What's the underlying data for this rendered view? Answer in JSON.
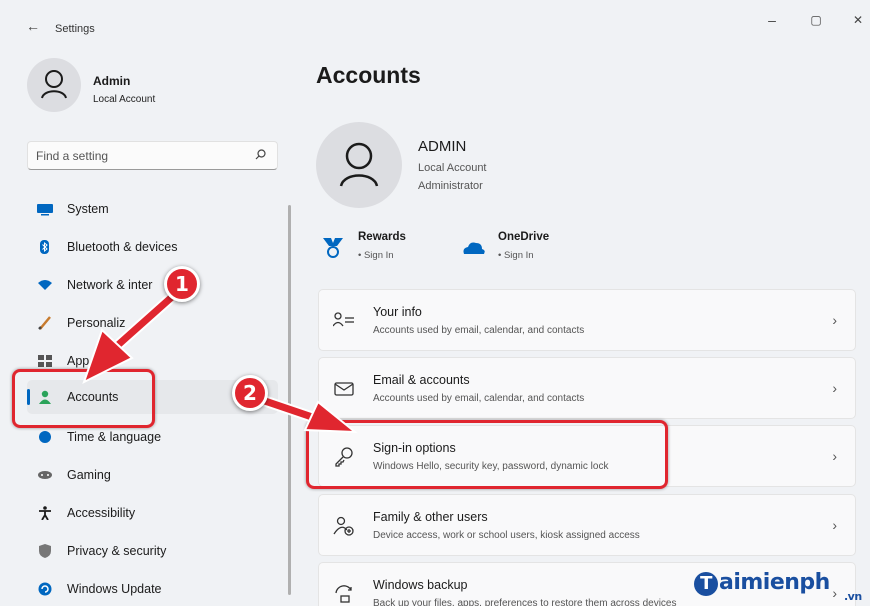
{
  "window": {
    "title": "Settings",
    "back_glyph": "←",
    "controls": {
      "minimize": "–",
      "maximize": "▢",
      "close": "✕"
    }
  },
  "sidebar": {
    "user": {
      "name": "Admin",
      "type": "Local Account"
    },
    "search": {
      "placeholder": "Find a setting"
    },
    "items": [
      {
        "label": "System",
        "icon": "monitor-icon",
        "color": "#0067c0"
      },
      {
        "label": "Bluetooth & devices",
        "icon": "bluetooth-icon",
        "color": "#0067c0"
      },
      {
        "label": "Network & inter",
        "icon": "wifi-icon",
        "color": "#0067c0"
      },
      {
        "label": "Personaliz",
        "icon": "brush-icon",
        "color": "#c77b2e"
      },
      {
        "label": "App",
        "icon": "apps-icon",
        "color": "#555555"
      },
      {
        "label": "Accounts",
        "icon": "person-icon",
        "color": "#2aa35a",
        "active": true
      },
      {
        "label": "Time & language",
        "icon": "globe-icon",
        "color": "#0067c0"
      },
      {
        "label": "Gaming",
        "icon": "gamepad-icon",
        "color": "#666666"
      },
      {
        "label": "Accessibility",
        "icon": "accessibility-icon",
        "color": "#1b1b1b"
      },
      {
        "label": "Privacy & security",
        "icon": "shield-icon",
        "color": "#777777"
      },
      {
        "label": "Windows Update",
        "icon": "update-icon",
        "color": "#0067c0"
      }
    ]
  },
  "main": {
    "title": "Accounts",
    "account": {
      "name": "ADMIN",
      "type": "Local Account",
      "role": "Administrator"
    },
    "services": [
      {
        "title": "Rewards",
        "sub": "• Sign In",
        "icon": "rewards-icon"
      },
      {
        "title": "OneDrive",
        "sub": "• Sign In",
        "icon": "onedrive-icon"
      }
    ],
    "cards": [
      {
        "title": "Your info",
        "desc": "Accounts used by email, calendar, and contacts",
        "icon": "your-info-icon"
      },
      {
        "title": "Email & accounts",
        "desc": "Accounts used by email, calendar, and contacts",
        "icon": "mail-icon"
      },
      {
        "title": "Sign-in options",
        "desc": "Windows Hello, security key, password, dynamic lock",
        "icon": "key-icon"
      },
      {
        "title": "Family & other users",
        "desc": "Device access, work or school users, kiosk assigned access",
        "icon": "family-icon"
      },
      {
        "title": "Windows backup",
        "desc": "Back up your files, apps, preferences to restore them across devices",
        "icon": "backup-icon"
      }
    ],
    "chevron": "›"
  },
  "annotations": {
    "step1": "1",
    "step2": "2",
    "color": "#e0262f"
  },
  "watermark": {
    "letter": "T",
    "text": "aimienph",
    "suffix": ".vn"
  }
}
